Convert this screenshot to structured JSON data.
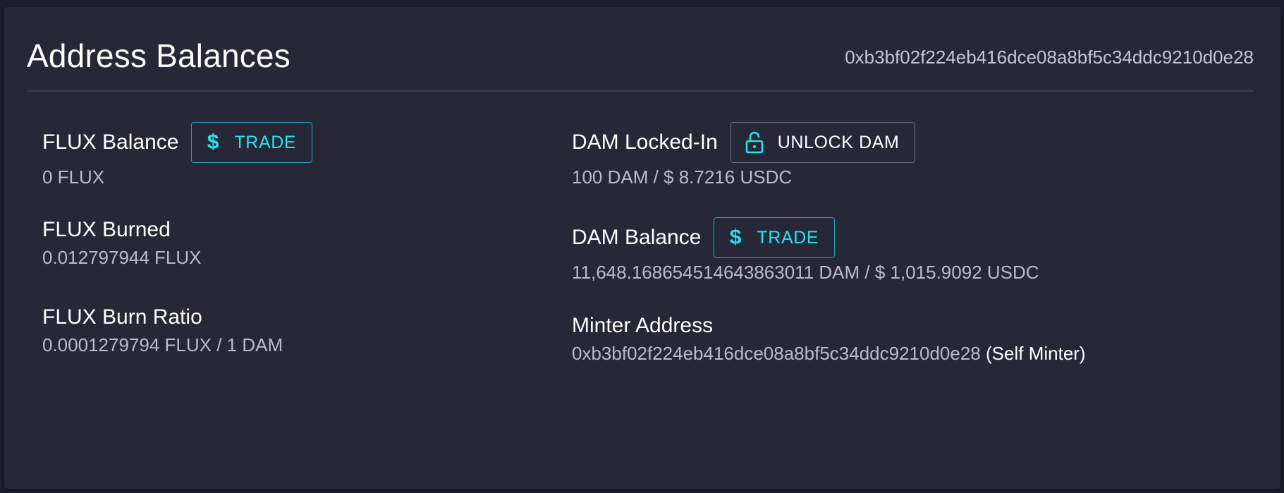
{
  "header": {
    "title": "Address Balances",
    "address": "0xb3bf02f224eb416dce08a8bf5c34ddc9210d0e28"
  },
  "left": {
    "flux_balance": {
      "label": "FLUX Balance",
      "value": "0 FLUX",
      "button_label": "TRADE",
      "button_icon": "dollar-icon"
    },
    "flux_burned": {
      "label": "FLUX Burned",
      "value": "0.012797944 FLUX"
    },
    "flux_burn_ratio": {
      "label": "FLUX Burn Ratio",
      "value": "0.0001279794 FLUX / 1 DAM"
    }
  },
  "right": {
    "dam_locked_in": {
      "label": "DAM Locked-In",
      "value": "100 DAM / $ 8.7216 USDC",
      "button_label": "UNLOCK DAM",
      "button_icon": "unlock-icon"
    },
    "dam_balance": {
      "label": "DAM Balance",
      "value": "11,648.168654514643863011 DAM / $ 1,015.9092 USDC",
      "button_label": "TRADE",
      "button_icon": "dollar-icon"
    },
    "minter_address": {
      "label": "Minter Address",
      "value": "0xb3bf02f224eb416dce08a8bf5c34ddc9210d0e28",
      "suffix": "(Self Minter)"
    }
  },
  "colors": {
    "accent": "#22e4f0",
    "background": "#1c1e2b",
    "card": "#262837",
    "muted_text": "#b9bcc8"
  }
}
